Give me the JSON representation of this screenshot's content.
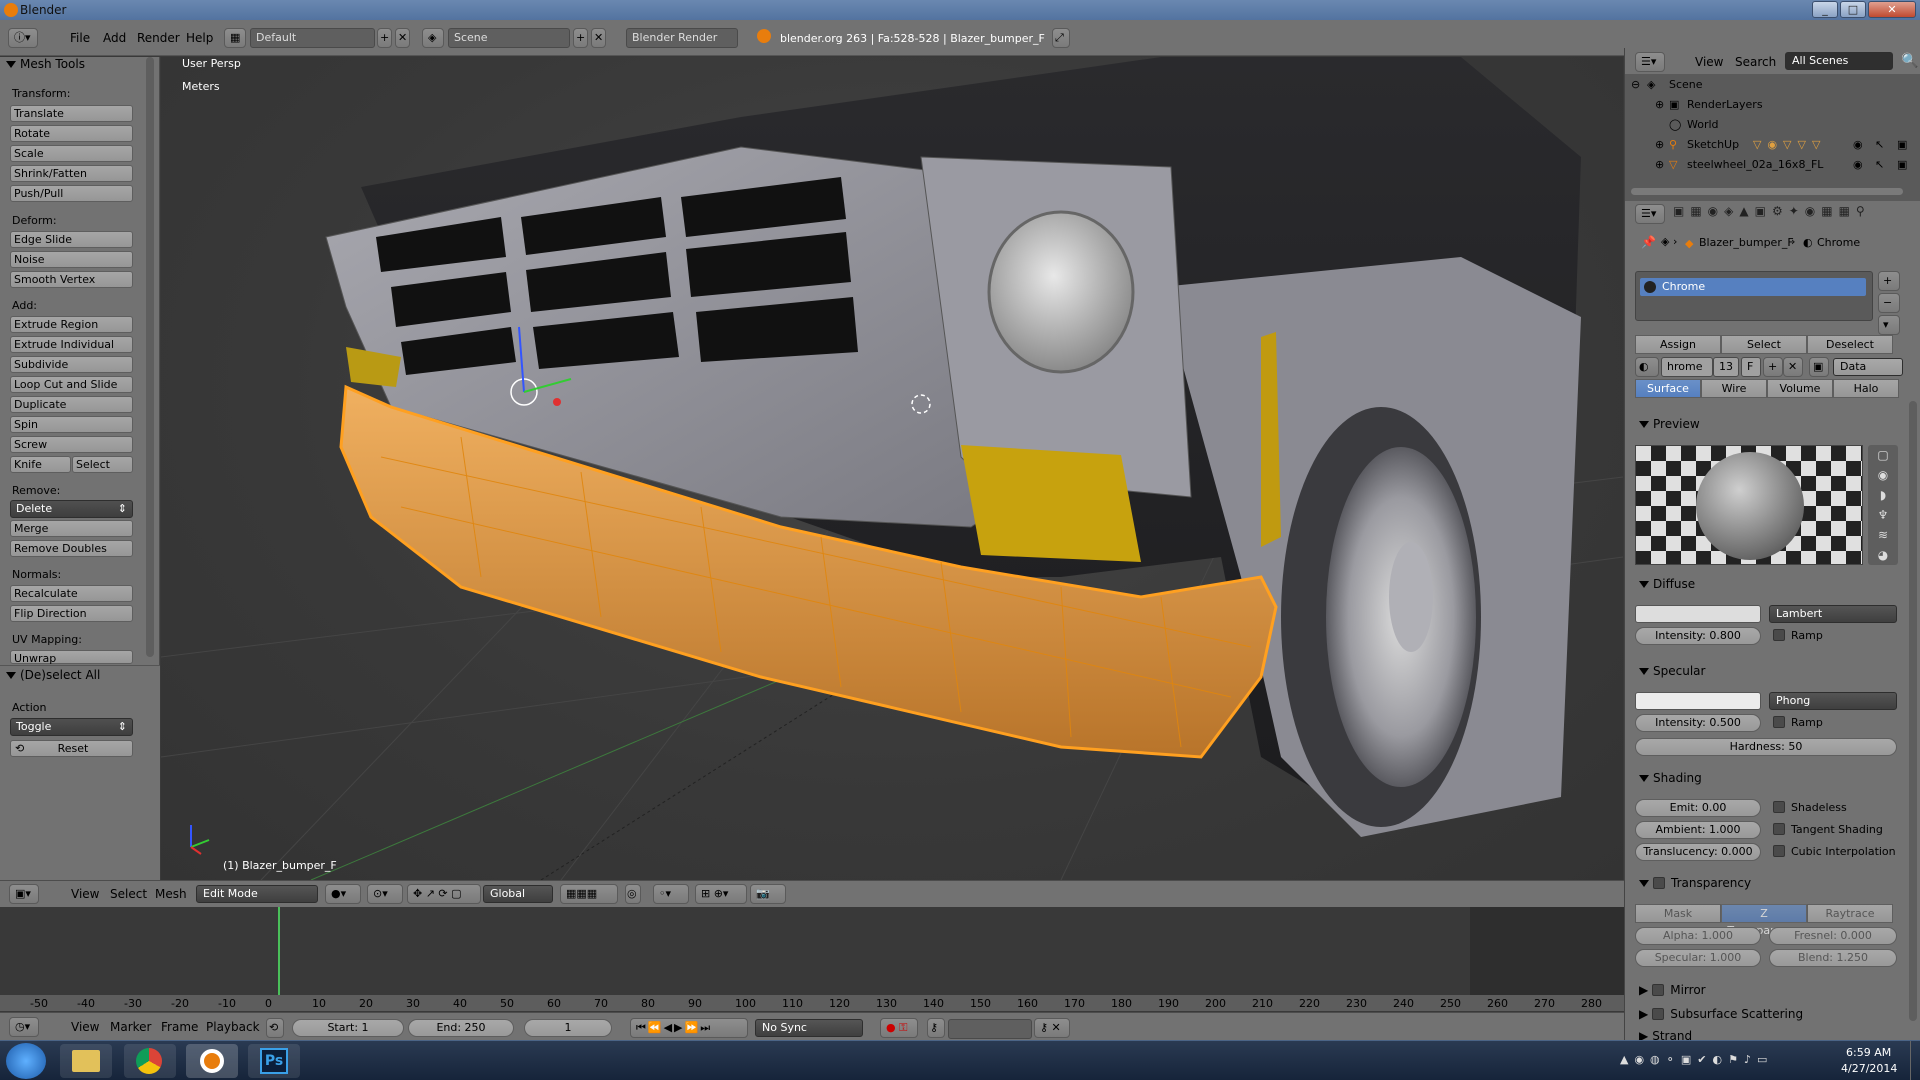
{
  "window": {
    "title": "Blender"
  },
  "info_header": {
    "menus": [
      "File",
      "Add",
      "Render",
      "Help"
    ],
    "screen_layout": "Default",
    "scene": "Scene",
    "render_engine": "Blender Render",
    "stats": "blender.org 263 | Fa:528-528 | Blazer_bumper_F"
  },
  "tool_shelf": {
    "panel_title": "Mesh Tools",
    "sections": {
      "transform": "Transform:",
      "deform": "Deform:",
      "add": "Add:",
      "remove": "Remove:",
      "normals": "Normals:",
      "uv": "UV Mapping:"
    },
    "transform_buttons": [
      "Translate",
      "Rotate",
      "Scale",
      "Shrink/Fatten",
      "Push/Pull"
    ],
    "deform_buttons": [
      "Edge Slide",
      "Noise",
      "Smooth Vertex"
    ],
    "add_buttons": [
      "Extrude Region",
      "Extrude Individual",
      "Subdivide",
      "Loop Cut and Slide",
      "Duplicate",
      "Spin",
      "Screw"
    ],
    "knife": "Knife",
    "knife_select": "Select",
    "remove_select": "Delete",
    "remove_buttons": [
      "Merge",
      "Remove Doubles"
    ],
    "normals_buttons": [
      "Recalculate",
      "Flip Direction"
    ],
    "uv_button": "Unwrap",
    "operator_panel": "(De)select All",
    "action_label": "Action",
    "action_value": "Toggle",
    "reset": "Reset"
  },
  "viewport": {
    "view_name": "User Persp",
    "units": "Meters",
    "object_label": "(1) Blazer_bumper_F"
  },
  "view3d_header": {
    "menus": [
      "View",
      "Select",
      "Mesh"
    ],
    "mode": "Edit Mode",
    "orientation": "Global"
  },
  "timeline": {
    "ticks": [
      "-50",
      "-40",
      "-30",
      "-20",
      "-10",
      "0",
      "10",
      "20",
      "30",
      "40",
      "50",
      "60",
      "70",
      "80",
      "90",
      "100",
      "110",
      "120",
      "130",
      "140",
      "150",
      "160",
      "170",
      "180",
      "190",
      "200",
      "210",
      "220",
      "230",
      "240",
      "250",
      "260",
      "270",
      "280"
    ],
    "menus": [
      "View",
      "Marker",
      "Frame",
      "Playback"
    ],
    "start": "Start: 1",
    "end": "End: 250",
    "current": "1",
    "sync": "No Sync"
  },
  "outliner": {
    "menus": [
      "View",
      "Search"
    ],
    "filter": "All Scenes",
    "rows": [
      "Scene",
      "RenderLayers",
      "World",
      "SketchUp",
      "steelwheel_02a_16x8_FL"
    ]
  },
  "properties": {
    "breadcrumb_object": "Blazer_bumper_F",
    "breadcrumb_material": "Chrome",
    "slot": "Chrome",
    "slot_actions": [
      "Assign",
      "Select",
      "Deselect"
    ],
    "material_name": "hrome",
    "users": "13",
    "fake": "F",
    "link": "Data",
    "tabs": [
      "Surface",
      "Wire",
      "Volume",
      "Halo"
    ],
    "preview_title": "Preview",
    "diffuse_title": "Diffuse",
    "diffuse_shader": "Lambert",
    "diffuse_intensity": "Intensity: 0.800",
    "ramp": "Ramp",
    "specular_title": "Specular",
    "specular_shader": "Phong",
    "specular_intensity": "Intensity: 0.500",
    "hardness": "Hardness: 50",
    "shading_title": "Shading",
    "emit": "Emit: 0.00",
    "ambient": "Ambient: 1.000",
    "translucency": "Translucency: 0.000",
    "shadeless": "Shadeless",
    "tangent": "Tangent Shading",
    "cubic": "Cubic Interpolation",
    "transparency_title": "Transparency",
    "transp_tabs": [
      "Mask",
      "Z Transparency",
      "Raytrace"
    ],
    "alpha": "Alpha: 1.000",
    "fresnel": "Fresnel: 0.000",
    "specular_t": "Specular: 1.000",
    "blend": "Blend: 1.250",
    "mirror_title": "Mirror",
    "sss_title": "Subsurface Scattering",
    "strand_title": "Strand"
  },
  "taskbar": {
    "time": "6:59 AM",
    "date": "4/27/2014"
  },
  "colors": {
    "selection": "#e8962a",
    "active_blue": "#5680c0"
  }
}
